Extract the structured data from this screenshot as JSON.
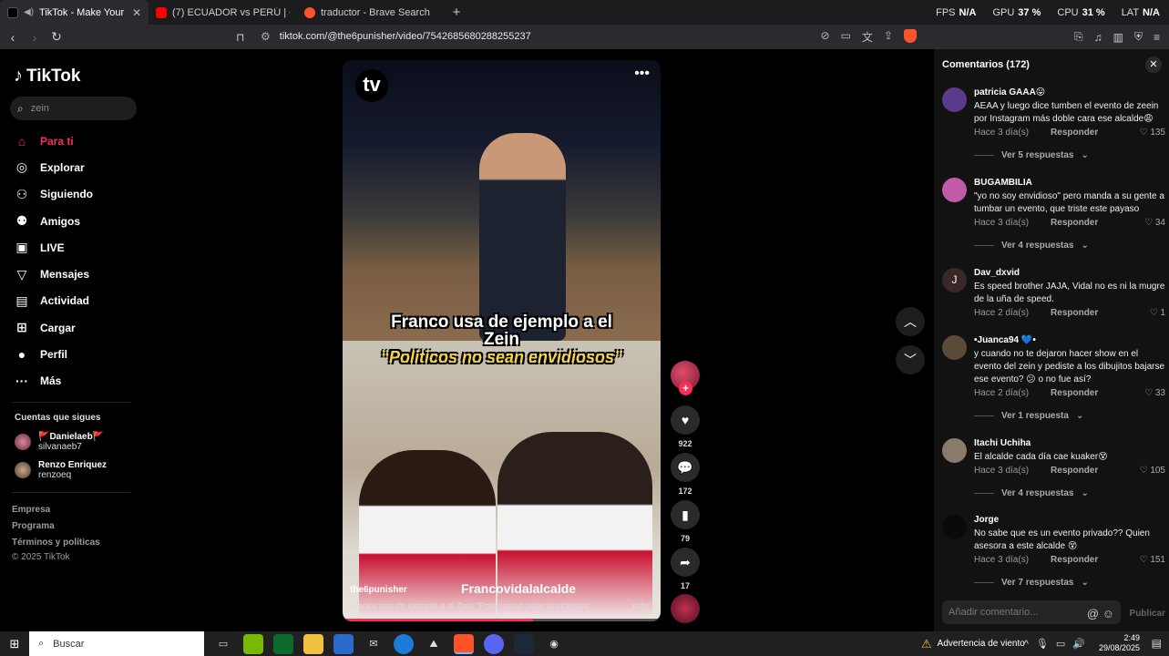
{
  "browser": {
    "tabs": [
      {
        "title": "TikTok - Make Your Day",
        "active": true
      },
      {
        "title": "(7) ECUADOR vs PERÚ | CUARTOS DE",
        "active": false
      },
      {
        "title": "traductor - Brave Search",
        "active": false
      }
    ],
    "new_tab": "+",
    "perf": {
      "fps_label": "FPS",
      "fps": "N/A",
      "gpu_label": "GPU",
      "gpu": "37 %",
      "cpu_label": "CPU",
      "cpu": "31 %",
      "lat_label": "LAT",
      "lat": "N/A"
    },
    "url": "tiktok.com/@the6punisher/video/7542685680288255237"
  },
  "sidebar": {
    "logo": "TikTok",
    "search_value": "zein",
    "nav": [
      {
        "label": "Para ti",
        "icon": "⌂",
        "active": true
      },
      {
        "label": "Explorar",
        "icon": "◎",
        "active": false
      },
      {
        "label": "Siguiendo",
        "icon": "⚇",
        "active": false
      },
      {
        "label": "Amigos",
        "icon": "⚉",
        "active": false
      },
      {
        "label": "LIVE",
        "icon": "▣",
        "active": false
      },
      {
        "label": "Mensajes",
        "icon": "▽",
        "active": false
      },
      {
        "label": "Actividad",
        "icon": "▤",
        "active": false
      },
      {
        "label": "Cargar",
        "icon": "⊞",
        "active": false
      },
      {
        "label": "Perfil",
        "icon": "●",
        "active": false
      },
      {
        "label": "Más",
        "icon": "···",
        "active": false
      }
    ],
    "following_title": "Cuentas que sigues",
    "following": [
      {
        "name": "🚩Danielaeb🚩",
        "handle": "silvanaeb7"
      },
      {
        "name": "Renzo Enriquez",
        "handle": "renzoeq"
      }
    ],
    "footer": [
      "Empresa",
      "Programa",
      "Términos y políticas",
      "© 2025 TikTok"
    ]
  },
  "video": {
    "caption_line1": "Franco usa de ejemplo a el",
    "caption_line1b": "Zein",
    "caption_line2": "“Políticos no sean envidiosos”",
    "author": "the6punisher",
    "watermark": "Francovidalalcalde",
    "description": "Franco usa de ejemplo a el Zein \"Politicos no sean envidiosos\" ...",
    "more": "más",
    "progress": 0.6
  },
  "actions": {
    "likes": "922",
    "comments": "172",
    "saves": "79",
    "shares": "17"
  },
  "comments": {
    "header": "Comentarios (172)",
    "items": [
      {
        "name": "patricia GAAA😛",
        "text": "AEAA y luego dice tumben el evento de zeein por Instagram más doble cara ese alcalde😩",
        "meta": "Hace 3 día(s)",
        "reply": "Responder",
        "likes": "135",
        "replies": "Ver 5 respuestas",
        "color": "#5a3a8a"
      },
      {
        "name": "BUGAMBILIA",
        "text": "\"yo no soy envidioso\" pero manda a su gente a tumbar un evento, que triste este payaso",
        "meta": "Hace 3 día(s)",
        "reply": "Responder",
        "likes": "34",
        "replies": "Ver 4 respuestas",
        "color": "#c25aa8"
      },
      {
        "name": "Dav_dxvid",
        "text": "Es speed brother JAJA, Vidal no es ni la mugre de la uña de speed.",
        "meta": "Hace 2 día(s)",
        "reply": "Responder",
        "likes": "1",
        "replies": "",
        "color": "#3a2828"
      },
      {
        "name": "•Juanca94 💙•",
        "text": "y cuando no te dejaron hacer show en el evento del zein y pediste a los dibujitos bajarse ese evento? 😕 o no fue así?",
        "meta": "Hace 2 día(s)",
        "reply": "Responder",
        "likes": "33",
        "replies": "Ver 1 respuesta",
        "color": "#5a4a3a"
      },
      {
        "name": "Itachi Uchiha",
        "text": "El alcalde cada día cae kuaker😵",
        "meta": "Hace 3 día(s)",
        "reply": "Responder",
        "likes": "105",
        "replies": "Ver 4 respuestas",
        "color": "#8a7a6a"
      },
      {
        "name": "Jorge",
        "text": "No sabe que es un evento privado?? Quien asesora a este alcalde 😵",
        "meta": "Hace 3 día(s)",
        "reply": "Responder",
        "likes": "151",
        "replies": "Ver 7 respuestas",
        "color": "#0a0a0a"
      }
    ],
    "input_placeholder": "Añadir comentario...",
    "post": "Publicar"
  },
  "taskbar": {
    "search": "Buscar",
    "warning": "Advertencia de viento",
    "time": "2:49",
    "date": "29/08/2025"
  }
}
